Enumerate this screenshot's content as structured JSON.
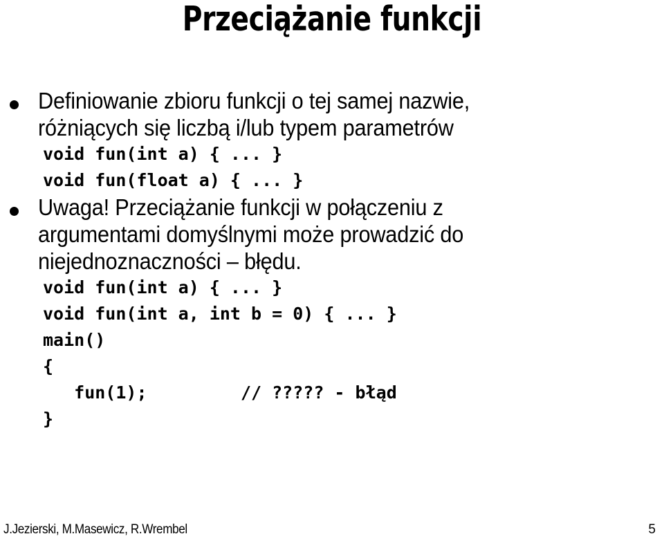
{
  "slide": {
    "title": "Przeciążanie funkcji",
    "background_color": "#ffffff",
    "text_color": "#000000"
  },
  "content": {
    "bullet1": {
      "marker": "•",
      "text": "Definiowanie zbioru funkcji o tej samej nazwie, różniących się liczbą i/lub typem parametrów"
    },
    "code1": {
      "line1": "void fun(int a) { ... }",
      "line2": "void fun(float a) { ... }"
    },
    "bullet2": {
      "marker": "•",
      "text": "Uwaga! Przeciążanie funkcji w połączeniu z argumentami domyślnymi może prowadzić do niejednoznaczności – błędu."
    },
    "code2": {
      "line1": "void fun(int a) { ... }",
      "line2": "void fun(int a, int b = 0) { ... }",
      "line3": "main()",
      "line4": "{",
      "line5": "   fun(1);         // ????? - błąd",
      "line6": "}"
    }
  },
  "footer": {
    "authors": "J.Jezierski, M.Masewicz, R.Wrembel",
    "page_number": "5"
  }
}
